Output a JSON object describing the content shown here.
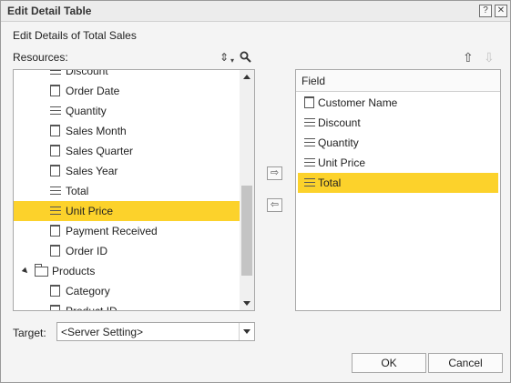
{
  "dialog": {
    "title": "Edit Detail Table",
    "help_label": "?",
    "close_label": "✕",
    "heading": "Edit Details of Total Sales"
  },
  "resources": {
    "label": "Resources:",
    "sort_icon": "⇕",
    "search_icon": "search-icon",
    "items": [
      {
        "label": "Discount",
        "icon": "lines",
        "selected": false
      },
      {
        "label": "Order Date",
        "icon": "doc",
        "selected": false
      },
      {
        "label": "Quantity",
        "icon": "lines",
        "selected": false
      },
      {
        "label": "Sales Month",
        "icon": "doc",
        "selected": false
      },
      {
        "label": "Sales Quarter",
        "icon": "doc",
        "selected": false
      },
      {
        "label": "Sales Year",
        "icon": "doc",
        "selected": false
      },
      {
        "label": "Total",
        "icon": "lines",
        "selected": false
      },
      {
        "label": "Unit Price",
        "icon": "lines",
        "selected": true
      },
      {
        "label": "Payment Received",
        "icon": "doc",
        "selected": false
      },
      {
        "label": "Order ID",
        "icon": "doc",
        "selected": false
      },
      {
        "label": "Products",
        "icon": "folder",
        "selected": false
      },
      {
        "label": "Category",
        "icon": "doc",
        "selected": false
      },
      {
        "label": "Product ID",
        "icon": "doc",
        "selected": false
      }
    ]
  },
  "move": {
    "add_label": "⇨",
    "remove_label": "⇦"
  },
  "field_list": {
    "header": "Field",
    "up_label": "⇧",
    "down_label": "⇩",
    "items": [
      {
        "label": "Customer Name",
        "icon": "doc",
        "selected": false
      },
      {
        "label": "Discount",
        "icon": "lines",
        "selected": false
      },
      {
        "label": "Quantity",
        "icon": "lines",
        "selected": false
      },
      {
        "label": "Unit Price",
        "icon": "lines",
        "selected": false
      },
      {
        "label": "Total",
        "icon": "lines",
        "selected": true
      }
    ]
  },
  "target": {
    "label": "Target:",
    "value": "<Server Setting>"
  },
  "buttons": {
    "ok": "OK",
    "cancel": "Cancel"
  },
  "colors": {
    "selection": "#fcd22b"
  }
}
